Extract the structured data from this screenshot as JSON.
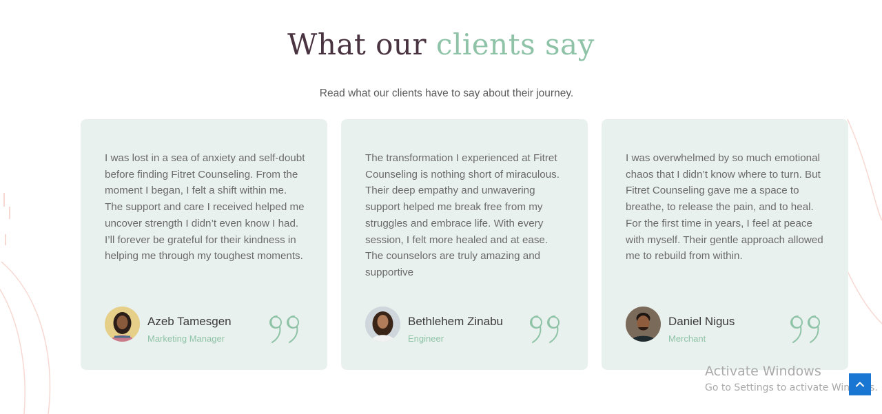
{
  "section": {
    "title_main": "What our ",
    "title_accent": "clients say",
    "subtitle": "Read what our clients have to say about their journey."
  },
  "testimonials": [
    {
      "text": "I was lost in a sea of anxiety and self-doubt before finding Fitret Counseling. From the moment I began, I felt a shift within me. The support and care I received helped me uncover strength I didn’t even know I had. I’ll forever be grateful for their kindness in helping me through my toughest moments.",
      "name": "Azeb Tamesgen",
      "role": "Marketing Manager"
    },
    {
      "text": "The transformation I experienced at Fitret Counseling is nothing short of miraculous. Their deep empathy and unwavering support helped me break free from my struggles and embrace life. With every session, I felt more healed and at ease. The counselors are truly amazing and supportive",
      "name": "Bethlehem Zinabu",
      "role": "Engineer"
    },
    {
      "text": "I was overwhelmed by so much emotional chaos that I didn’t know where to turn. But Fitret Counseling gave me a space to breathe, to release the pain, and to heal. For the first time in years, I feel at peace with myself. Their gentle approach allowed me to rebuild from within.",
      "name": "Daniel Nigus",
      "role": "Merchant"
    }
  ],
  "watermark": {
    "title": "Activate Windows",
    "subtitle": "Go to Settings to activate Windows."
  },
  "colors": {
    "heading": "#4a3340",
    "accent": "#8fc3a7",
    "card_bg": "#e9f1ee",
    "scroll_button": "#1976d2"
  },
  "icons": [
    "quote-icon",
    "chevron-up-icon"
  ]
}
